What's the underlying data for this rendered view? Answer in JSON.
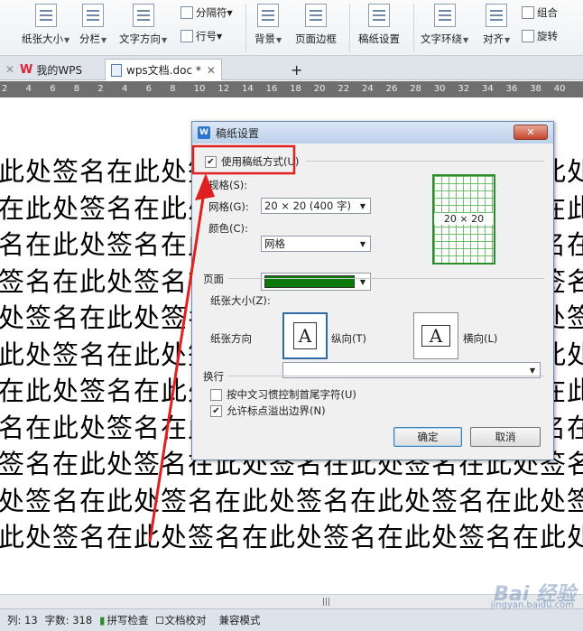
{
  "ribbon": {
    "paper_size": "纸张大小",
    "columns": "分栏",
    "text_direction": "文字方向",
    "separator": "分隔符",
    "line_number": "行号",
    "background": "背景",
    "page_border": "页面边框",
    "draft_setup": "稿纸设置",
    "text_wrap": "文字环绕",
    "align": "对齐",
    "group": "组合",
    "rotate": "旋转"
  },
  "tabs": {
    "my_wps": "我的WPS",
    "doc_title": "wps文档.doc *",
    "add": "+"
  },
  "ruler": [
    "2",
    "4",
    "6",
    "8",
    "2",
    "4",
    "6",
    "8",
    "10",
    "12",
    "14",
    "16",
    "18",
    "20",
    "22",
    "24",
    "26",
    "28",
    "30",
    "32",
    "34",
    "36",
    "38",
    "40"
  ],
  "document": {
    "lines": [
      "此处签名在此处签名在此处签名在此处签名在此处签名在此处签名在此处",
      "在此处签名在此处签名在此处签名在此处签名在此处签名在此处签名在此处",
      "名在此处签名在此处签名在此处签名在此处签名在此处签名在此处签名",
      "签名在此处签名在此处签名在此处签名在此处签名在此处签名在此处签名",
      "处签名在此处签名在此处签名在此处签名在此处签名在此处签名在此处签",
      "此处签名在此处签名在此处签名在此处签名在此处签名在此处签名在此处",
      "在此处签名在此处签名在此处签名在此处签名在此处签名在此处签名在此",
      "名在此处签名在此处签名在此处签名在此处签名在此处签名在此处签名",
      "签名在此处签名在此处签名在此处签名在此处签名在此处签名在此处签",
      "处签名在此处签名在此处签名在此处签名在此处签名在此处签名在此处",
      "此处签名在此处签名在此处签名在此处签名在此处签名在此处签名在此"
    ]
  },
  "dialog": {
    "title": "稿纸设置",
    "close": "✕",
    "use_draft": "使用稿纸方式",
    "use_draft_key": "(U)",
    "use_draft_checked": true,
    "spec_label": "规格",
    "spec_key": "(S):",
    "spec_value": "20 × 20 (400 字)",
    "grid_label": "网格",
    "grid_key": "(G):",
    "grid_value": "网格",
    "color_label": "颜色",
    "color_key": "(C):",
    "color_value": "#0b7a0b",
    "preview_label": "20 × 20",
    "page_section": "页面",
    "paper_size_label": "纸张大小",
    "paper_size_key": "(Z):",
    "paper_size_value": "",
    "orientation_label": "纸张方向",
    "portrait_label": "纵向",
    "portrait_key": "(T)",
    "landscape_label": "横向",
    "landscape_key": "(L)",
    "orient_glyph": "A",
    "wrap_section": "换行",
    "opt_chinese": "按中文习惯控制首尾字符",
    "opt_chinese_key": "(U)",
    "opt_chinese_checked": false,
    "opt_punct": "允许标点溢出边界",
    "opt_punct_key": "(N)",
    "opt_punct_checked": true,
    "ok": "确定",
    "cancel": "取消"
  },
  "status": {
    "column": "列: 13",
    "word_count": "字数: 318",
    "spell_check": "拼写检查",
    "doc_check": "文档校对",
    "compat_mode": "兼容模式",
    "scroll_grip": "|||"
  },
  "watermark": {
    "text": "Bai 经验",
    "url": "jingyan.baidu.com"
  },
  "colors": {
    "highlight": "#e02020",
    "draft_green": "#0b7a0b"
  }
}
